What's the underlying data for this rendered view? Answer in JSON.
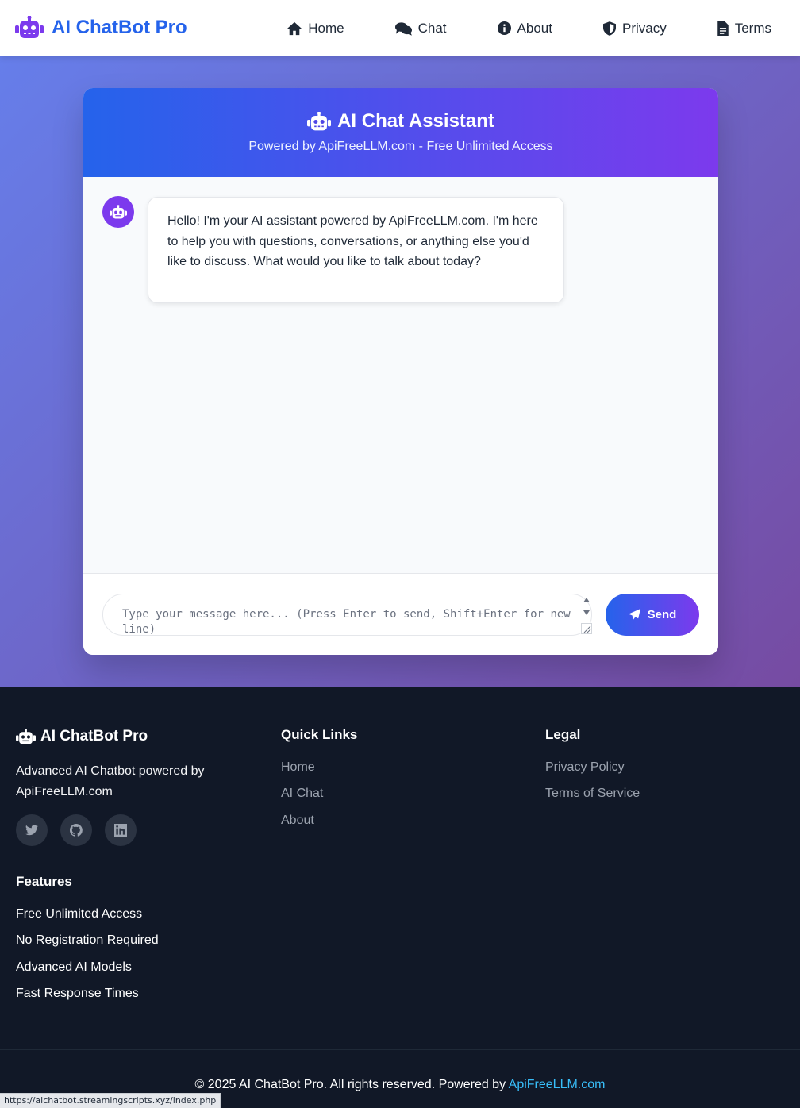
{
  "nav": {
    "brand": "AI ChatBot Pro",
    "brand_icon": "robot-icon",
    "links": [
      {
        "label": "Home",
        "icon": "home-icon"
      },
      {
        "label": "Chat",
        "icon": "comments-icon"
      },
      {
        "label": "About",
        "icon": "info-circle-icon"
      },
      {
        "label": "Privacy",
        "icon": "shield-icon"
      },
      {
        "label": "Terms",
        "icon": "document-icon"
      }
    ]
  },
  "chat": {
    "title": "AI Chat Assistant",
    "subtitle": "Powered by ApiFreeLLM.com - Free Unlimited Access",
    "messages": [
      {
        "sender": "bot",
        "text": "Hello! I'm your AI assistant powered by ApiFreeLLM.com. I'm here to help you with questions, conversations, or anything else you'd like to discuss. What would you like to talk about today?"
      }
    ],
    "input_placeholder": "Type your message here... (Press Enter to send, Shift+Enter for new line)",
    "input_value": "",
    "send_label": "Send"
  },
  "footer": {
    "brand": "AI ChatBot Pro",
    "description": "Advanced AI Chatbot powered by ApiFreeLLM.com",
    "social": [
      "twitter-icon",
      "github-icon",
      "linkedin-icon"
    ],
    "quick_links": {
      "title": "Quick Links",
      "items": [
        "Home",
        "AI Chat",
        "About"
      ]
    },
    "legal": {
      "title": "Legal",
      "items": [
        "Privacy Policy",
        "Terms of Service"
      ]
    },
    "features": {
      "title": "Features",
      "items": [
        "Free Unlimited Access",
        "No Registration Required",
        "Advanced AI Models",
        "Fast Response Times"
      ]
    },
    "copyright_text": "© 2025 AI ChatBot Pro. All rights reserved. Powered by",
    "copyright_link": "ApiFreeLLM.com"
  },
  "status_bar": {
    "url": "https://aichatbot.streamingscripts.xyz/index.php"
  },
  "colors": {
    "brand_blue": "#2563eb",
    "brand_purple": "#7c3aed",
    "hero_gradient_start": "#667eea",
    "hero_gradient_end": "#764ba2",
    "footer_bg": "#111827",
    "link_accent": "#38bdf8"
  }
}
